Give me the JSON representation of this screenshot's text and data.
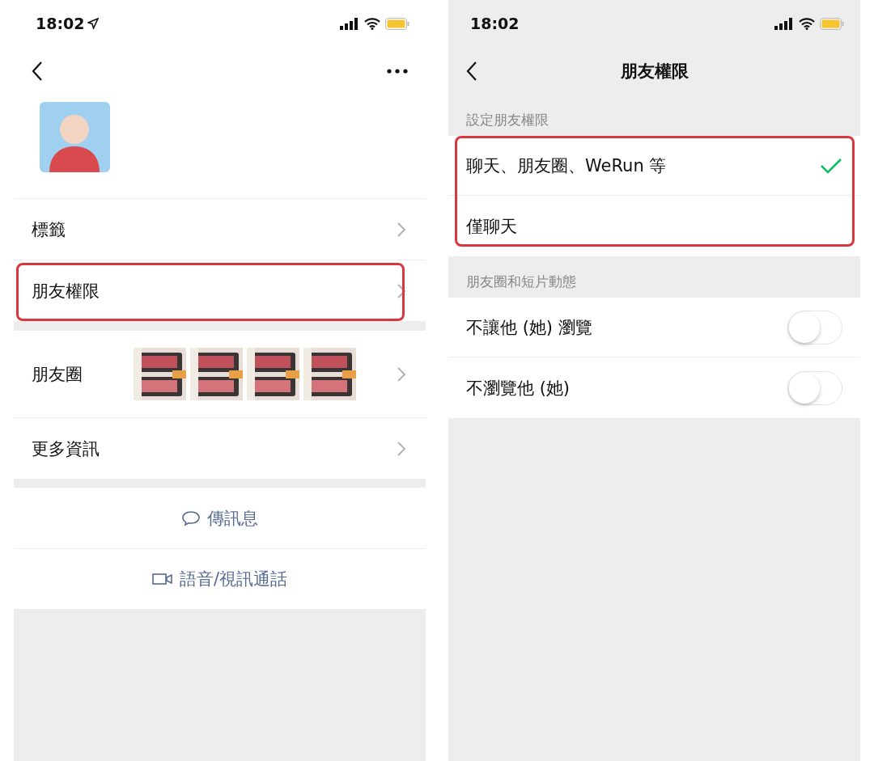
{
  "profile_screen": {
    "status_bar": {
      "time": "18:02",
      "location_arrow": true
    },
    "rows": [
      {
        "label": "標籤",
        "kind": "link",
        "highlighted": false
      },
      {
        "label": "朋友權限",
        "kind": "link",
        "highlighted": true
      },
      {
        "label": "朋友圈",
        "kind": "moments",
        "highlighted": false
      },
      {
        "label": "更多資訊",
        "kind": "link",
        "highlighted": false
      }
    ],
    "actions": [
      {
        "label": "傳訊息",
        "kind": "message"
      },
      {
        "label": "語音/視訊通話",
        "kind": "call"
      }
    ]
  },
  "permissions_screen": {
    "status_bar": {
      "time": "18:02",
      "location_arrow": false
    },
    "title": "朋友權限",
    "sections": [
      {
        "header": "設定朋友權限",
        "highlighted": true,
        "items": [
          {
            "label": "聊天、朋友圈、WeRun 等",
            "kind": "option",
            "selected": true
          },
          {
            "label": "僅聊天",
            "kind": "option",
            "selected": false
          }
        ]
      },
      {
        "header": "朋友圈和短片動態",
        "highlighted": false,
        "items": [
          {
            "label": "不讓他 (她) 瀏覽",
            "kind": "switch",
            "on": false
          },
          {
            "label": "不瀏覽他 (她)",
            "kind": "switch",
            "on": false
          }
        ]
      }
    ]
  }
}
